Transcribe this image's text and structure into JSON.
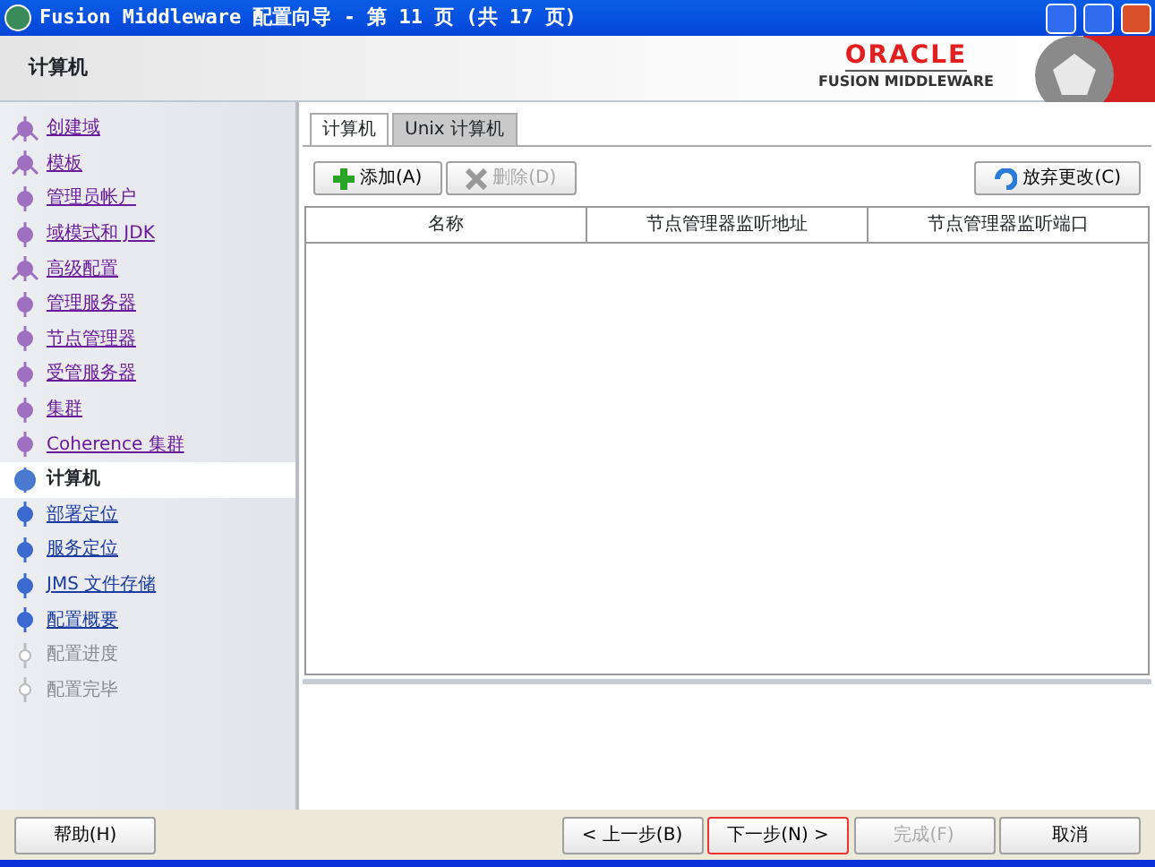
{
  "window": {
    "title": "Fusion Middleware 配置向导 - 第 11 页 (共 17 页)"
  },
  "header": {
    "title": "计算机",
    "logo_brand": "ORACLE",
    "logo_product": "FUSION MIDDLEWARE"
  },
  "steps": [
    {
      "label": "创建域",
      "kind": "done",
      "branch": true
    },
    {
      "label": "模板",
      "kind": "done",
      "branch": true
    },
    {
      "label": "管理员帐户",
      "kind": "done",
      "branch": false
    },
    {
      "label": "域模式和 JDK",
      "kind": "done",
      "branch": false
    },
    {
      "label": "高级配置",
      "kind": "done",
      "branch": true
    },
    {
      "label": "管理服务器",
      "kind": "done",
      "branch": false
    },
    {
      "label": "节点管理器",
      "kind": "done",
      "branch": false
    },
    {
      "label": "受管服务器",
      "kind": "done",
      "branch": false
    },
    {
      "label": "集群",
      "kind": "done",
      "branch": false
    },
    {
      "label": "Coherence 集群",
      "kind": "done",
      "branch": false
    },
    {
      "label": "计算机",
      "kind": "current",
      "branch": false
    },
    {
      "label": "部署定位",
      "kind": "next",
      "branch": false
    },
    {
      "label": "服务定位",
      "kind": "next",
      "branch": false
    },
    {
      "label": "JMS 文件存储",
      "kind": "next",
      "branch": false
    },
    {
      "label": "配置概要",
      "kind": "next",
      "branch": false
    },
    {
      "label": "配置进度",
      "kind": "pending",
      "branch": false
    },
    {
      "label": "配置完毕",
      "kind": "pending",
      "branch": false
    }
  ],
  "tabs": [
    {
      "label": "计算机",
      "selected": true
    },
    {
      "label": "Unix 计算机",
      "selected": false
    }
  ],
  "toolbar": [
    {
      "label": "添加(A)",
      "kind": "add",
      "disabled": false
    },
    {
      "label": "删除(D)",
      "kind": "delete",
      "disabled": true
    }
  ],
  "discard_button": {
    "label": "放弃更改(C)"
  },
  "table": {
    "columns": [
      "名称",
      "节点管理器监听地址",
      "节点管理器监听端口"
    ]
  },
  "footer": {
    "help": "帮助(H)",
    "buttons": [
      {
        "label": "< 上一步(B)",
        "focused": false,
        "disabled": false
      },
      {
        "label": "下一步(N) >",
        "focused": true,
        "disabled": false
      },
      {
        "label": "完成(F)",
        "focused": false,
        "disabled": true
      },
      {
        "label": "取消",
        "focused": false,
        "disabled": false
      }
    ]
  }
}
